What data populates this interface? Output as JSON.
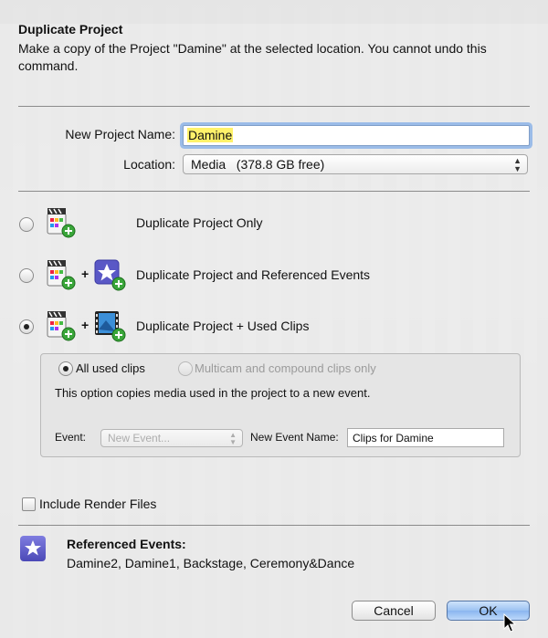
{
  "dialog": {
    "title": "Duplicate Project",
    "description": "Make a copy of the Project \"Damine\" at the selected location. You cannot undo this command."
  },
  "form": {
    "project_name_label": "New Project Name:",
    "project_name_value": "Damine",
    "location_label": "Location:",
    "location_value": "Media   (378.8 GB free)"
  },
  "options": [
    {
      "label": "Duplicate Project Only",
      "selected": false
    },
    {
      "label": "Duplicate Project and Referenced Events",
      "selected": false
    },
    {
      "label": "Duplicate Project + Used Clips",
      "selected": true
    }
  ],
  "used_clips": {
    "all_clips_label": "All used clips",
    "multicam_label": "Multicam and compound clips only",
    "info": "This option copies media used in the project to a new event.",
    "event_label": "Event:",
    "event_value": "New Event...",
    "event_name_label": "New Event Name:",
    "event_name_value": "Clips for Damine"
  },
  "render": {
    "label": "Include Render Files",
    "checked": false
  },
  "referenced": {
    "title": "Referenced Events:",
    "list": "Damine2, Damine1, Backstage, Ceremony&Dance"
  },
  "buttons": {
    "cancel": "Cancel",
    "ok": "OK"
  },
  "icons": {
    "project_plus": "project-plus-icon",
    "event_plus": "event-plus-icon",
    "clip_plus": "clip-plus-icon",
    "star_event": "star-event-icon"
  },
  "colors": {
    "accent": "#4b49b7",
    "highlight": "#fff26a",
    "focus": "#5a96e6"
  }
}
